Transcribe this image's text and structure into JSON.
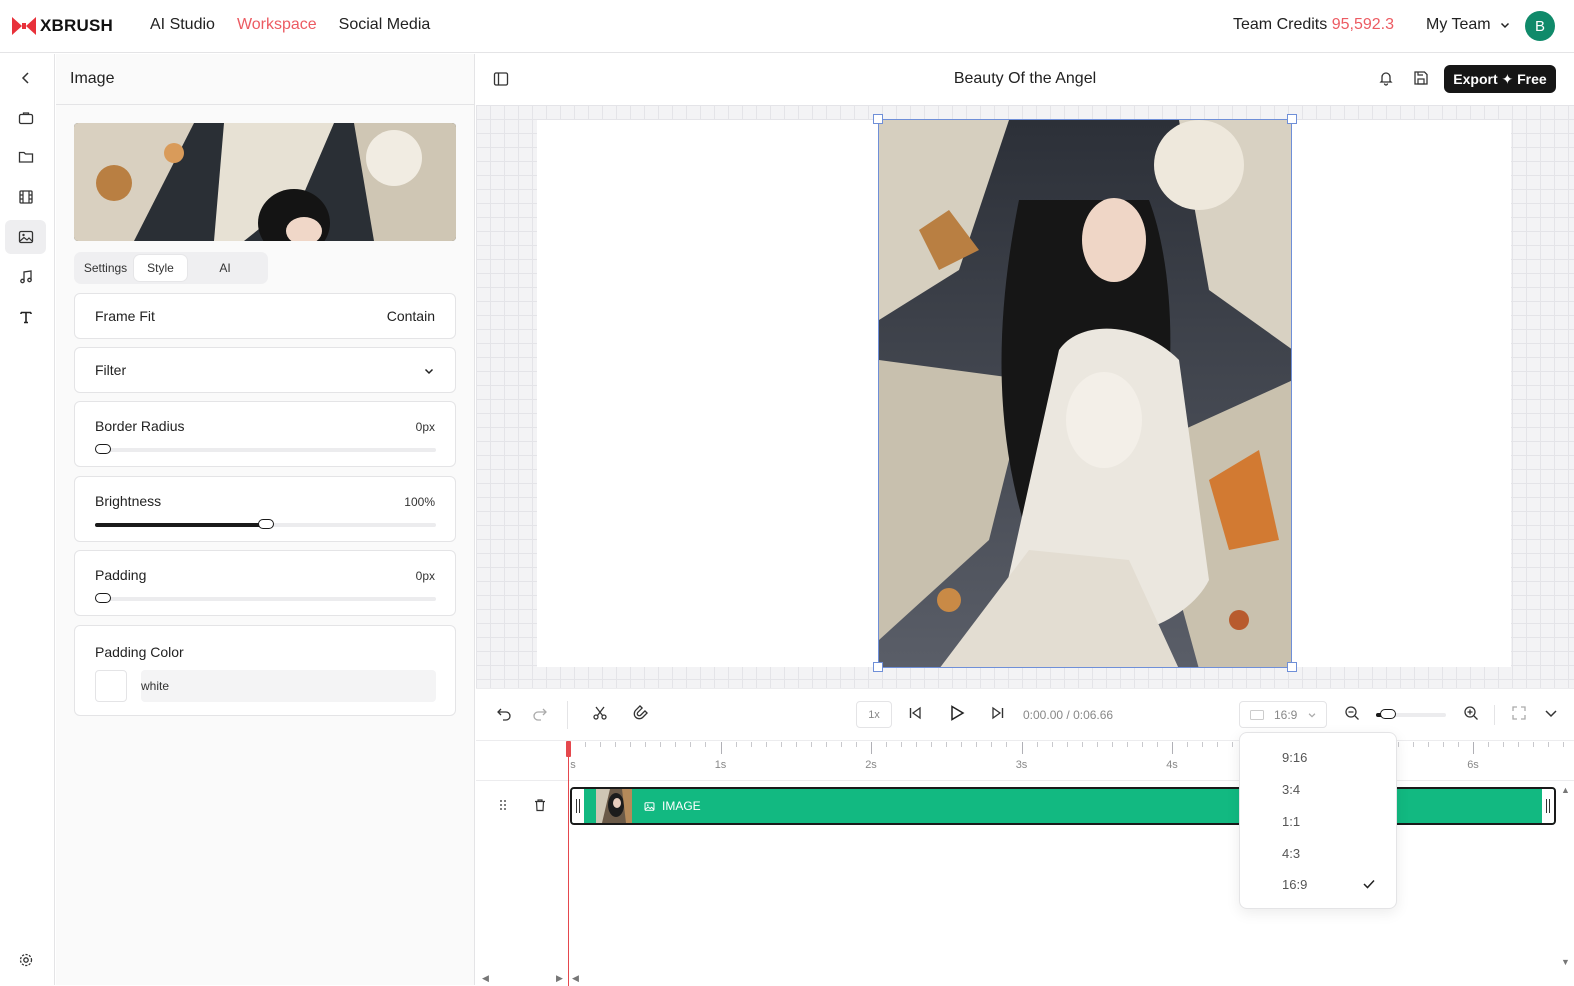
{
  "app": {
    "logo_text": "XBRUSH",
    "brand_color": "#e8313a",
    "accent_color": "#ec5b62"
  },
  "topnav": [
    {
      "label": "AI Studio",
      "active": false
    },
    {
      "label": "Workspace",
      "active": true
    },
    {
      "label": "Social Media",
      "active": false
    }
  ],
  "account": {
    "credits_label": "Team Credits",
    "credits_value": "95,592.3",
    "team_label": "My Team",
    "avatar_initial": "B",
    "avatar_color": "#108a6a"
  },
  "rail": [
    "back-icon",
    "briefcase-icon",
    "folder-icon",
    "film-icon",
    "image-icon",
    "music-icon",
    "text-icon",
    "settings-icon"
  ],
  "panel": {
    "title": "Image",
    "tabs": [
      "Settings",
      "Style",
      "AI"
    ],
    "active_tab": "Style",
    "frame_fit": {
      "label": "Frame Fit",
      "value": "Contain"
    },
    "filter": {
      "label": "Filter"
    },
    "border_radius": {
      "label": "Border Radius",
      "value": "0px",
      "fraction": 0
    },
    "brightness": {
      "label": "Brightness",
      "value": "100%",
      "fraction": 0.5
    },
    "padding": {
      "label": "Padding",
      "value": "0px",
      "fraction": 0
    },
    "padding_color": {
      "label": "Padding Color",
      "value": "white",
      "swatch": "#ffffff"
    }
  },
  "editor": {
    "title": "Beauty Of the Angel",
    "export_label": "Export ✦ Free",
    "canvas_bg": "#ffffff",
    "selection_color": "#6f8fd8"
  },
  "toolbar": {
    "speed": "1x",
    "time_current": "0:00.00",
    "time_total": "0:06.66",
    "aspect": "16:9",
    "zoom_fraction": 0.1
  },
  "timeline": {
    "ruler_labels": [
      "s",
      "1s",
      "2s",
      "3s",
      "4s",
      "6s"
    ],
    "clip_label": "IMAGE",
    "clip_color": "#12b981",
    "playhead_color": "#e5484d"
  },
  "aspect_menu": {
    "options": [
      "9:16",
      "3:4",
      "1:1",
      "4:3",
      "16:9"
    ],
    "selected": "16:9"
  }
}
